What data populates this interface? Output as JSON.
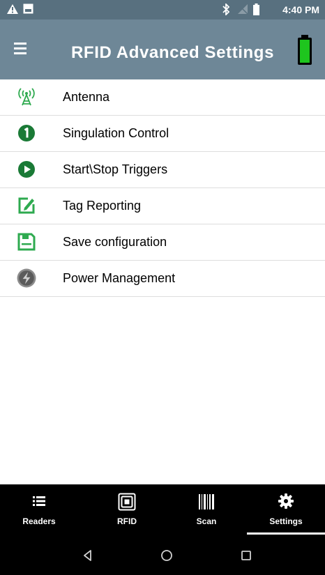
{
  "status_bar": {
    "time": "4:40 PM",
    "icons": [
      "alert-icon",
      "image-icon",
      "bluetooth-icon",
      "no-signal-icon",
      "battery-icon"
    ]
  },
  "app_bar": {
    "title": "RFID Advanced Settings",
    "menu_icon": "hamburger-menu-icon",
    "battery_icon": "reader-battery-icon",
    "battery_color": "#1ec51e"
  },
  "menu": {
    "items": [
      {
        "label": "Antenna",
        "icon": "antenna-icon"
      },
      {
        "label": "Singulation Control",
        "icon": "number-one-icon"
      },
      {
        "label": "Start\\Stop Triggers",
        "icon": "play-icon"
      },
      {
        "label": "Tag Reporting",
        "icon": "edit-icon"
      },
      {
        "label": "Save configuration",
        "icon": "save-icon"
      },
      {
        "label": "Power Management",
        "icon": "power-management-icon"
      }
    ],
    "accent_color": "#2eaa4f"
  },
  "bottom_nav": {
    "tabs": [
      {
        "label": "Readers",
        "icon": "list-icon"
      },
      {
        "label": "RFID",
        "icon": "rfid-icon"
      },
      {
        "label": "Scan",
        "icon": "barcode-icon"
      },
      {
        "label": "Settings",
        "icon": "gear-icon"
      }
    ],
    "selected": "Settings"
  },
  "system_nav": {
    "buttons": [
      "back-icon",
      "home-icon",
      "recents-icon"
    ]
  }
}
